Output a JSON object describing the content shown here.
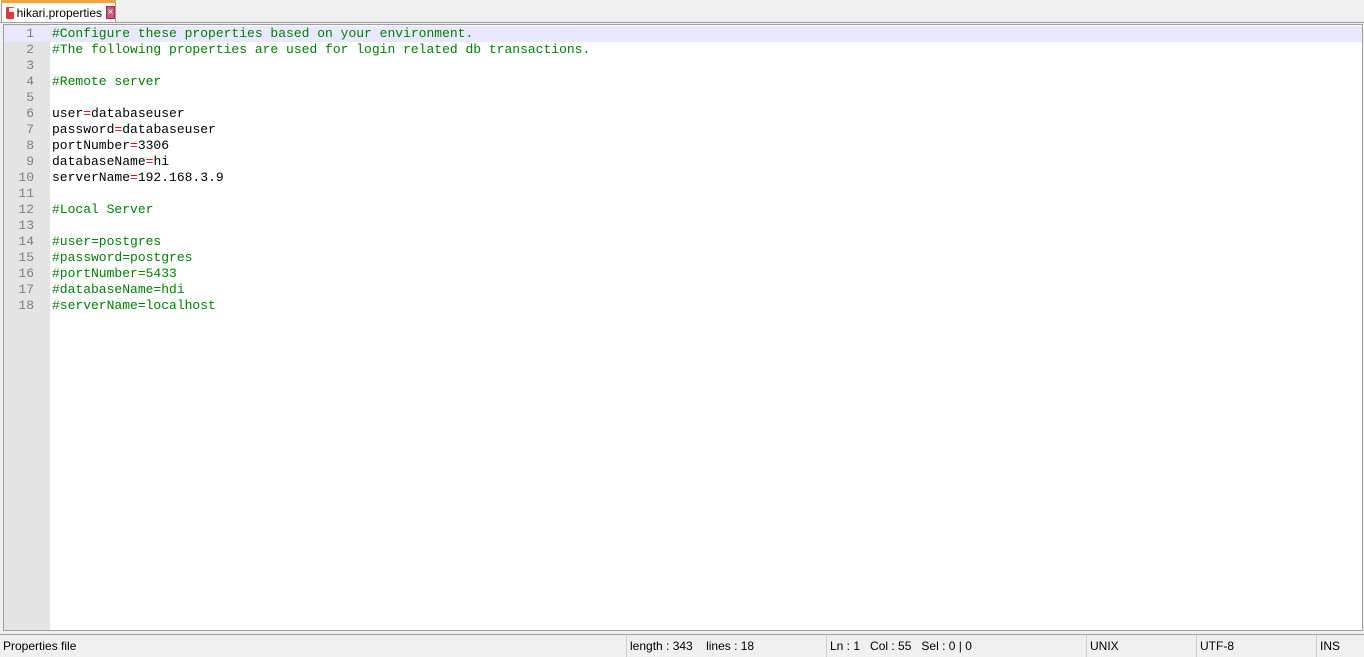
{
  "tab": {
    "title": "hikari.properties"
  },
  "lines": [
    {
      "n": "1",
      "type": "comment",
      "text": "#Configure these properties based on your environment."
    },
    {
      "n": "2",
      "type": "comment",
      "text": "#The following properties are used for login related db transactions."
    },
    {
      "n": "3",
      "type": "blank",
      "text": ""
    },
    {
      "n": "4",
      "type": "comment",
      "text": "#Remote server"
    },
    {
      "n": "5",
      "type": "blank",
      "text": ""
    },
    {
      "n": "6",
      "type": "kv",
      "key": "user",
      "value": "databaseuser"
    },
    {
      "n": "7",
      "type": "kv",
      "key": "password",
      "value": "databaseuser"
    },
    {
      "n": "8",
      "type": "kv",
      "key": "portNumber",
      "value": "3306"
    },
    {
      "n": "9",
      "type": "kv",
      "key": "databaseName",
      "value": "hi"
    },
    {
      "n": "10",
      "type": "kv",
      "key": "serverName",
      "value": "192.168.3.9"
    },
    {
      "n": "11",
      "type": "blank",
      "text": ""
    },
    {
      "n": "12",
      "type": "comment",
      "text": "#Local Server"
    },
    {
      "n": "13",
      "type": "blank",
      "text": ""
    },
    {
      "n": "14",
      "type": "comment",
      "text": "#user=postgres"
    },
    {
      "n": "15",
      "type": "comment",
      "text": "#password=postgres"
    },
    {
      "n": "16",
      "type": "comment",
      "text": "#portNumber=5433"
    },
    {
      "n": "17",
      "type": "comment",
      "text": "#databaseName=hdi"
    },
    {
      "n": "18",
      "type": "comment",
      "text": "#serverName=localhost"
    }
  ],
  "status": {
    "filetype": "Properties file",
    "length": "length : 343",
    "lines": "lines : 18",
    "ln": "Ln : 1",
    "col": "Col : 55",
    "sel": "Sel : 0 | 0",
    "eol": "UNIX",
    "encoding": "UTF-8",
    "mode": "INS"
  }
}
